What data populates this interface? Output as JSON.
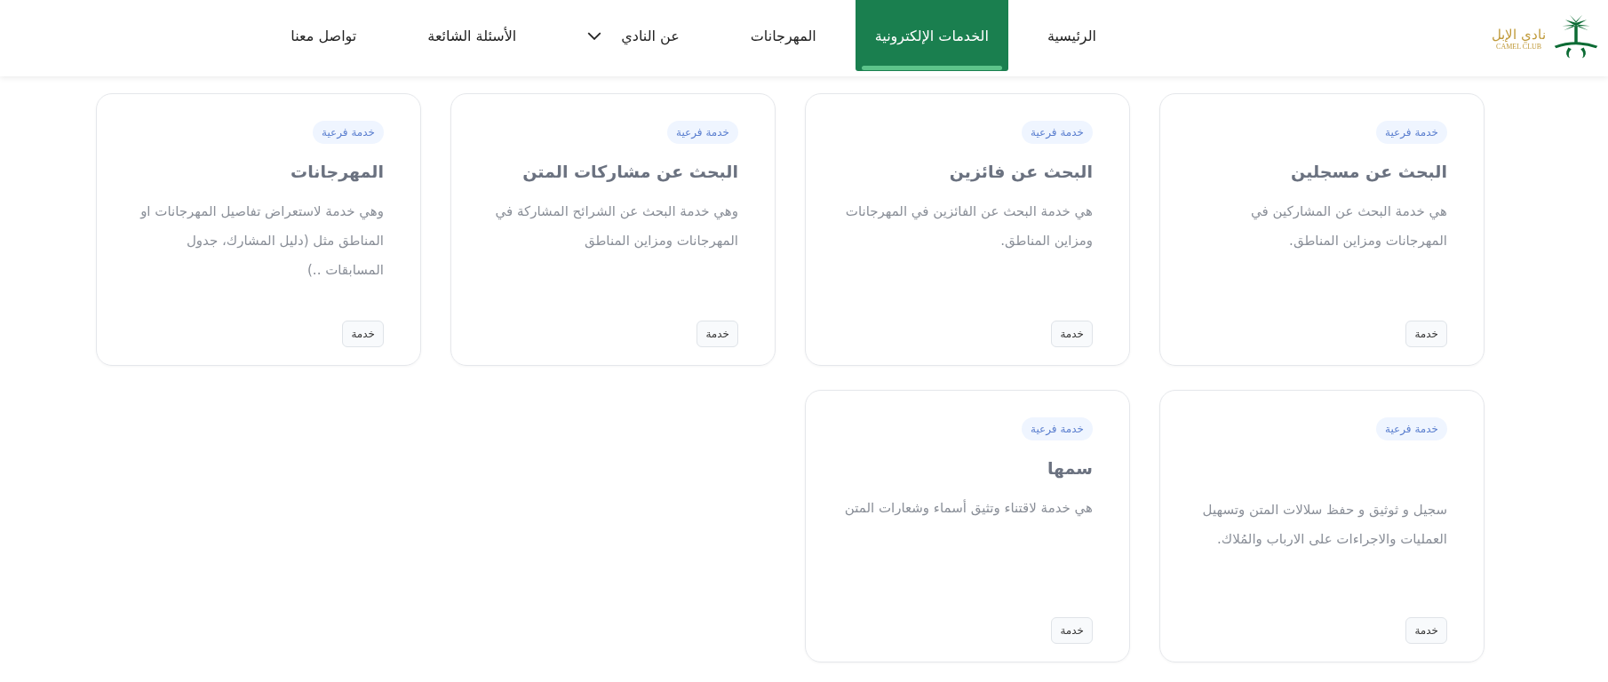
{
  "logo": {
    "arabic": "نادي الإبل",
    "english": "CAMEL CLUB"
  },
  "nav": [
    {
      "label": "الرئيسية",
      "selected": false,
      "dropdown": false
    },
    {
      "label": "الخدمات الإلكترونية",
      "selected": true,
      "dropdown": false
    },
    {
      "label": "المهرجانات",
      "selected": false,
      "dropdown": false
    },
    {
      "label": "عن النادي",
      "selected": false,
      "dropdown": true
    },
    {
      "label": "الأسئلة الشائعة",
      "selected": false,
      "dropdown": false
    },
    {
      "label": "تواصل معنا",
      "selected": false,
      "dropdown": false
    }
  ],
  "cards": [
    {
      "badge": "خدمة فرعية",
      "title": "البحث عن مسجلين",
      "description": "هي خدمة البحث عن المشاركين في المهرجانات ومزاين المناطق.",
      "button": "خدمة"
    },
    {
      "badge": "خدمة فرعية",
      "title": "البحث عن فائزين",
      "description": "هي خدمة البحث عن الفائزين في المهرجانات ومزاين المناطق.",
      "button": "خدمة"
    },
    {
      "badge": "خدمة فرعية",
      "title": "البحث عن مشاركات المتن",
      "description": "وهي خدمة البحث عن الشرائح المشاركة في المهرجانات ومزاين المناطق",
      "button": "خدمة"
    },
    {
      "badge": "خدمة فرعية",
      "title": "المهرجانات",
      "description": "وهي خدمة لاستعراض تفاصيل المهرجانات او المناطق مثل (دليل المشارك، جدول المسابقات ..)",
      "button": "خدمة"
    },
    {
      "badge": "خدمة فرعية",
      "description": "سجيل و ثوثيق و حفظ سلالات المتن وتسهيل العمليات والاجراءات على الارباب والمُلاك.",
      "button": "خدمة"
    },
    {
      "badge": "خدمة فرعية",
      "title": "سمها",
      "description": "هي خدمة لاقتناء وتثيق أسماء وشعارات المتن",
      "button": "خدمة"
    }
  ]
}
